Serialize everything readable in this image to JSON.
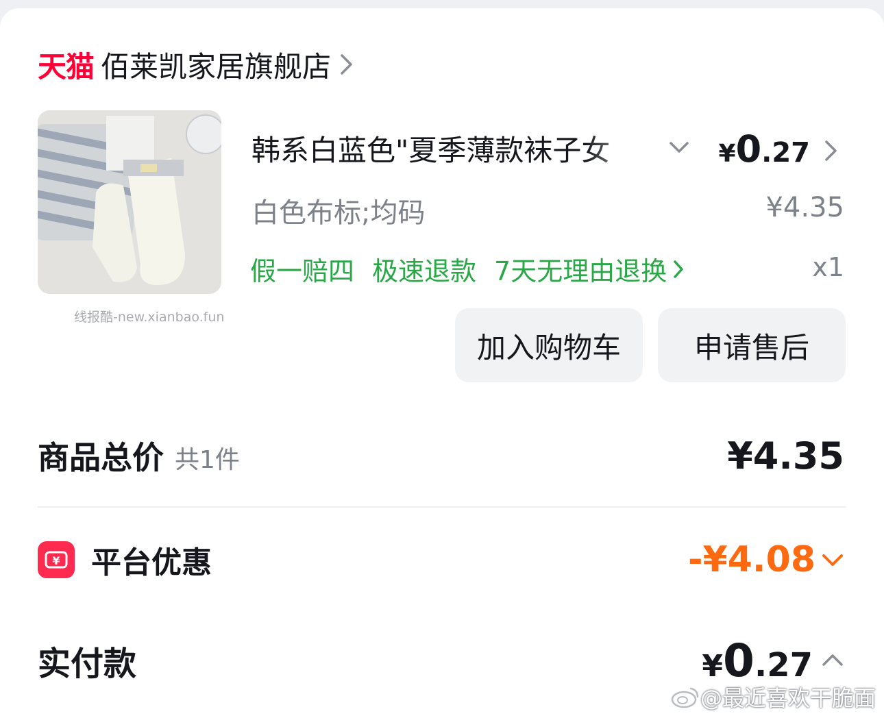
{
  "colors": {
    "tmall_red": "#ff0036",
    "service_green": "#2aa847",
    "discount_orange": "#ff6a10",
    "promo_icon_bg": "#ff2a4f",
    "text_primary": "#15171c",
    "text_secondary": "#7d8189"
  },
  "store": {
    "logo_text": "天猫",
    "name": "佰莱凯家居旗舰店",
    "chevron_icon": "chevron-right-icon"
  },
  "product": {
    "image_icon": "product-socks-image",
    "image_watermark": "线报酷-new.xianbao.fun",
    "title": "韩系白蓝色\"夏季薄款袜子女",
    "paid_price": {
      "currency": "¥",
      "integer": "0",
      "decimal": ".27"
    },
    "spec": "白色布标;均码",
    "original_price": "¥4.35",
    "services": [
      "假一赔四",
      "极速退款",
      "7天无理由退换"
    ],
    "quantity": "x1",
    "buttons": {
      "add_to_cart": "加入购物车",
      "after_sales": "申请售后"
    }
  },
  "summary": {
    "total_label": "商品总价",
    "total_count": "共1件",
    "total_amount": "¥4.35",
    "promo_icon": "yuan-coupon-icon",
    "promo_label": "平台优惠",
    "promo_amount": "-¥4.08",
    "paid_label": "实付款",
    "paid_amount": {
      "currency": "¥",
      "integer": "0",
      "decimal": ".27"
    }
  },
  "watermark": {
    "icon": "weibo-icon",
    "text": "@最近喜欢干脆面"
  }
}
